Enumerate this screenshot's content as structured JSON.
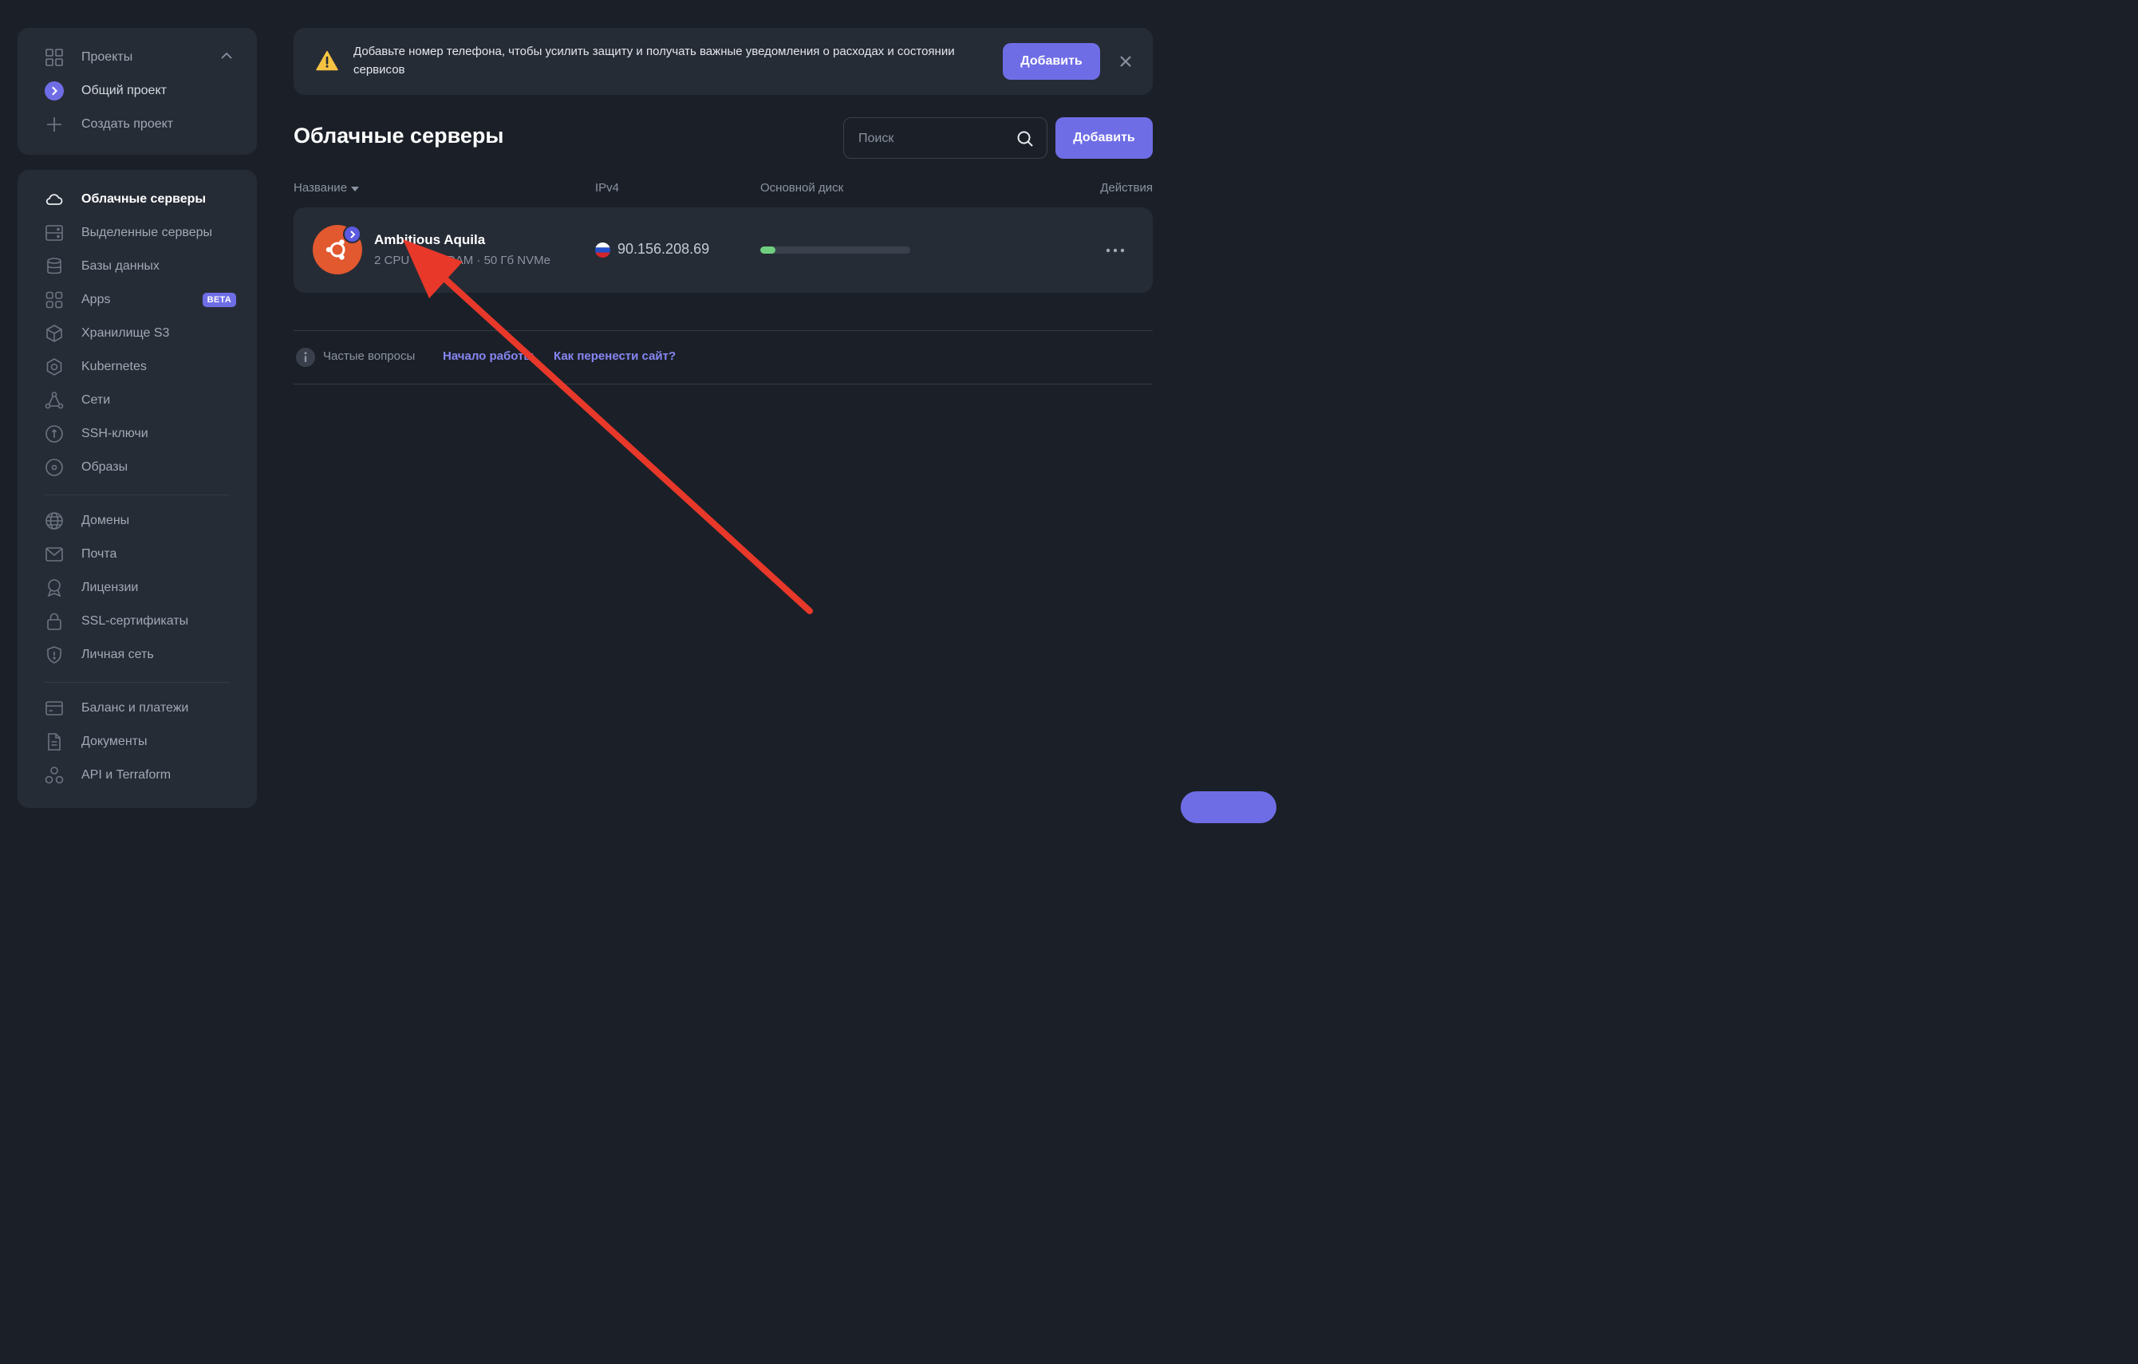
{
  "projects": {
    "header_label": "Проекты",
    "current_project": "Общий проект",
    "create_label": "Создать проект"
  },
  "nav": {
    "cloud_servers": "Облачные серверы",
    "dedicated_servers": "Выделенные серверы",
    "databases": "Базы данных",
    "apps": "Apps",
    "apps_badge": "BETA",
    "s3": "Хранилище S3",
    "kubernetes": "Kubernetes",
    "networks": "Сети",
    "ssh_keys": "SSH-ключи",
    "images": "Образы",
    "domains": "Домены",
    "mail": "Почта",
    "licenses": "Лицензии",
    "ssl": "SSL-сертификаты",
    "private_network": "Личная сеть",
    "billing": "Баланс и платежи",
    "documents": "Документы",
    "api": "API и Terraform"
  },
  "banner": {
    "text": "Добавьте номер телефона, чтобы усилить защиту и получать важные уведомления о расходах и состоянии сервисов",
    "button_label": "Добавить"
  },
  "main": {
    "title": "Облачные серверы",
    "search_placeholder": "Поиск",
    "add_label": "Добавить"
  },
  "table": {
    "columns": {
      "name": "Название",
      "ipv4": "IPv4",
      "disk": "Основной диск",
      "actions": "Действия"
    },
    "rows": [
      {
        "name": "Ambitious Aquila",
        "specs": "2 CPU · 4 Гб RAM · 50 Гб NVMe",
        "ip": "90.156.208.69",
        "disk_usage_fraction": 0.1,
        "os_icon": "ubuntu-logo",
        "flag": "russia-flag"
      }
    ]
  },
  "faq": {
    "label": "Частые вопросы",
    "link_start": "Начало работы",
    "link_move": "Как перенести сайт?"
  },
  "colors": {
    "accent": "#6f6de6",
    "background": "#1b2028",
    "panel": "#262c36",
    "ubuntu": "#e2582f",
    "disk_fill": "#6fcf7f",
    "annotation_arrow": "#e8382a"
  }
}
